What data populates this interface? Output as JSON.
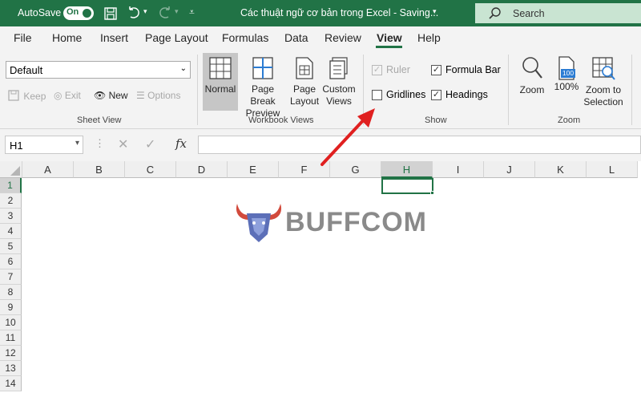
{
  "titlebar": {
    "autosave_label": "AutoSave",
    "autosave_state": "On",
    "document_title": "Các thuật ngữ cơ bản trong Excel - Saving...",
    "search_placeholder": "Search"
  },
  "menu": [
    "File",
    "Home",
    "Insert",
    "Page Layout",
    "Formulas",
    "Data",
    "Review",
    "View",
    "Help"
  ],
  "ribbon": {
    "sheet_view": {
      "dropdown_value": "Default",
      "keep_label": "Keep",
      "exit_label": "Exit",
      "new_label": "New",
      "options_label": "Options",
      "group_label": "Sheet View"
    },
    "workbook_views": {
      "normal_label": "Normal",
      "page_break_label_1": "Page Break",
      "page_break_label_2": "Preview",
      "page_layout_label_1": "Page",
      "page_layout_label_2": "Layout",
      "custom_views_label_1": "Custom",
      "custom_views_label_2": "Views",
      "group_label": "Workbook Views"
    },
    "show": {
      "ruler_label": "Ruler",
      "formula_bar_label": "Formula Bar",
      "gridlines_label": "Gridlines",
      "headings_label": "Headings",
      "group_label": "Show"
    },
    "zoom": {
      "zoom_label": "Zoom",
      "hundred_label": "100%",
      "hundred_icon_text": "100",
      "zoom_selection_label_1": "Zoom to",
      "zoom_selection_label_2": "Selection",
      "group_label": "Zoom"
    }
  },
  "formula_bar": {
    "name_box_value": "H1",
    "fx_label": "fx"
  },
  "grid": {
    "columns": [
      "A",
      "B",
      "C",
      "D",
      "E",
      "F",
      "G",
      "H",
      "I",
      "J",
      "K",
      "L"
    ],
    "rows": [
      "1",
      "2",
      "3",
      "4",
      "5",
      "6",
      "7",
      "8",
      "9",
      "10",
      "11",
      "12",
      "13",
      "14"
    ],
    "selected_cell": "H1"
  },
  "watermark": {
    "text": "BUFFCOM"
  },
  "colors": {
    "excel_green": "#217346",
    "annotation_red": "#e02020"
  }
}
